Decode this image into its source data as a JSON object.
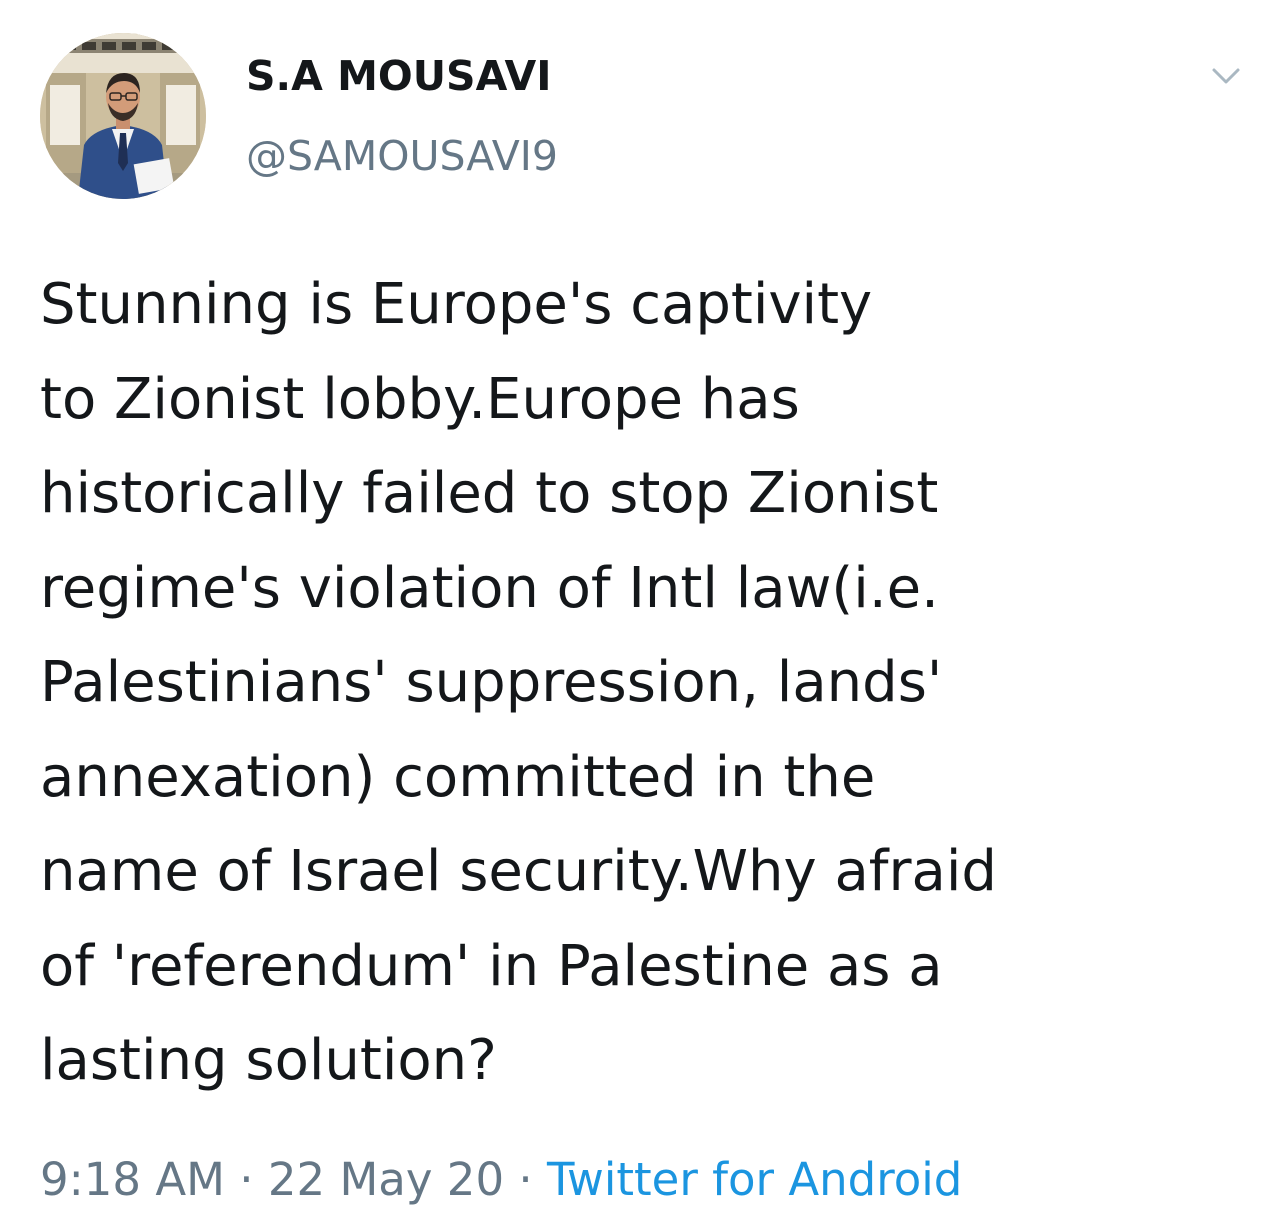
{
  "author": {
    "name": "S.A MOUSAVI",
    "handle": "@SAMOUSAVI9"
  },
  "tweet": {
    "lines": [
      "Stunning is Europe's captivity",
      "to Zionist lobby.Europe has",
      "historically failed to stop Zionist",
      "regime's violation of Intl law(i.e.",
      "Palestinians' suppression, lands'",
      "annexation) committed in the",
      "name of Israel security.Why afraid",
      "of 'referendum' in Palestine as a",
      "lasting solution?"
    ]
  },
  "meta": {
    "time": "9:18 AM",
    "separator": "·",
    "date": "22 May 20",
    "source": "Twitter for Android"
  },
  "icons": {
    "menu": "chevron-down-icon",
    "avatar": "avatar"
  },
  "colors": {
    "text": "#14171a",
    "muted": "#657786",
    "link": "#1b95e0",
    "caret": "#aab8c2",
    "background": "#ffffff"
  }
}
